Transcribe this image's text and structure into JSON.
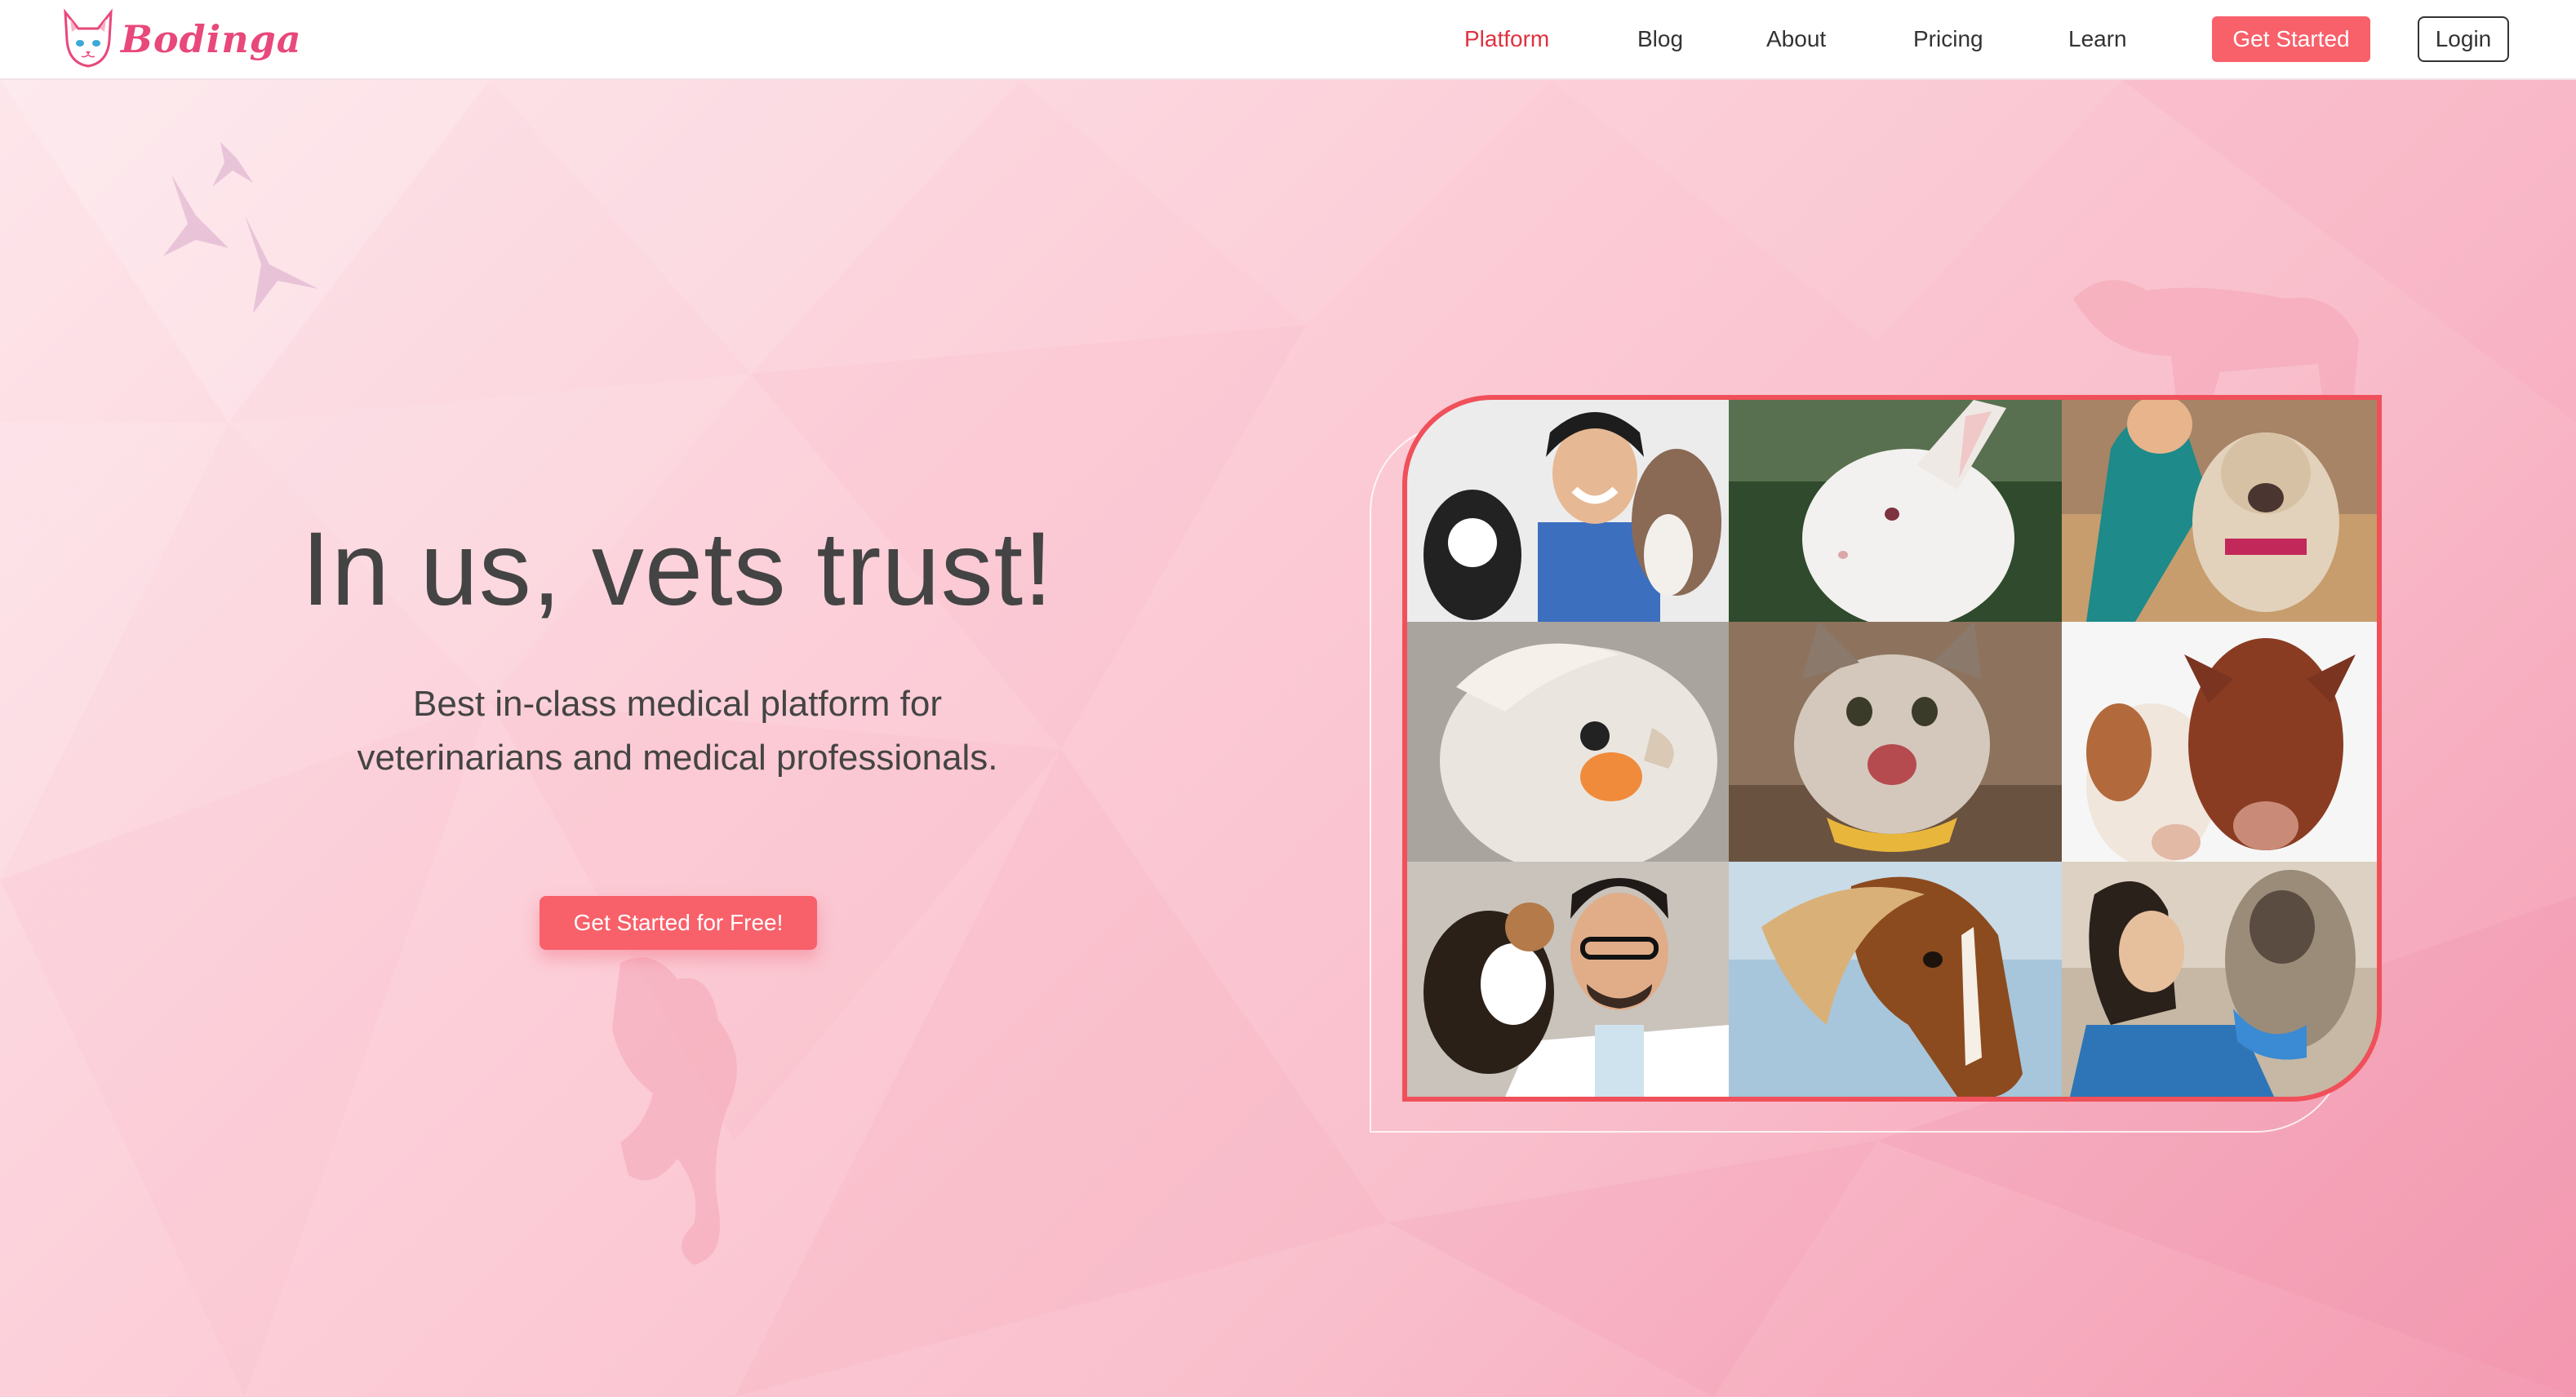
{
  "brand": {
    "name": "Bodinga",
    "accent": "#e8487a"
  },
  "nav": {
    "links": [
      "Platform",
      "Blog",
      "About",
      "Pricing",
      "Learn"
    ],
    "active": "Platform",
    "cta": "Get Started",
    "login": "Login"
  },
  "hero": {
    "title": "In us, vets trust!",
    "subtitle_line1": "Best in-class medical platform for",
    "subtitle_line2": "veterinarians and medical professionals.",
    "cta": "Get Started for Free!"
  },
  "colors": {
    "cta": "#f8606a",
    "active_link": "#e0313f",
    "frame": "#f0505a",
    "text": "#444444"
  },
  "photos": [
    "vet-with-puppies",
    "white-rabbit",
    "vet-with-french-bulldog",
    "cockatiel",
    "laughing-cat",
    "two-calves",
    "vet-with-dog",
    "chestnut-pony",
    "woman-with-yorkshire-terrier"
  ]
}
